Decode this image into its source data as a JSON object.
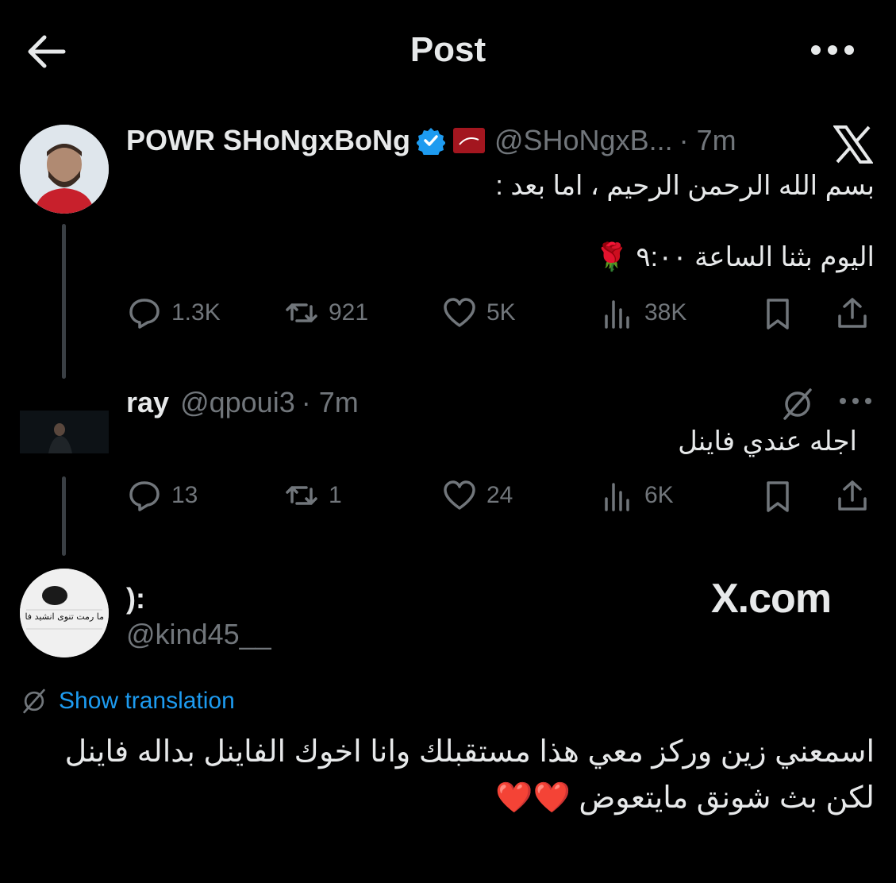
{
  "header": {
    "title": "Post"
  },
  "colors": {
    "background": "#000000",
    "text": "#e7e9ea",
    "muted": "#71767b",
    "accent": "#1d9bf0",
    "verified": "#1d9bf0"
  },
  "post1": {
    "display_name": "POWR SHoNgxBoNg",
    "handle": "@SHoNgxB...",
    "time": "· 7m",
    "line1": "بسم الله الرحمن الرحيم ، اما بعد :",
    "line2": "اليوم بثنا الساعة ٩:٠٠ 🌹",
    "replies": "1.3K",
    "reposts": "921",
    "likes": "5K",
    "views": "38K",
    "icons": [
      "verified-badge-icon",
      "affiliate-badge-icon",
      "x-logo-icon"
    ]
  },
  "post2": {
    "display_name": "ray",
    "handle": "@qpoui3",
    "time": "· 7m",
    "text": "اجله عندي فاينل",
    "replies": "13",
    "reposts": "1",
    "likes": "24",
    "views": "6K",
    "icons": [
      "grok-icon",
      "more-icon"
    ]
  },
  "post3": {
    "display_name": "):",
    "handle": "@kind45__",
    "watermark": "X.com",
    "show_translation": "Show translation",
    "line1": "اسمعني زين وركز معي هذا مستقبلك وانا اخوك الفاينل بداله فاينل",
    "line2": "لكن بث شونق مايتعوض ❤️❤️",
    "avatar_caption": "ما رمت تنوی انشید فانت"
  }
}
